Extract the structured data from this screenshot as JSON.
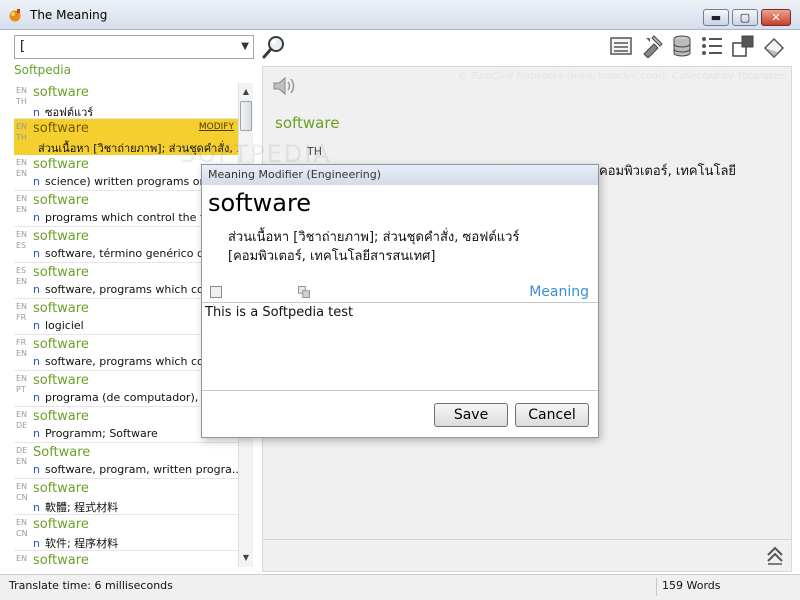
{
  "window": {
    "title": "The Meaning",
    "controls": {
      "minimize": "▬",
      "maximize": "▢",
      "close": "✕"
    }
  },
  "search": {
    "value": "[",
    "dropdown_icon": "▼"
  },
  "source": "Softpedia",
  "watermark": "SOFTPEDIA",
  "results": [
    {
      "lang1": "EN",
      "lang2": "TH",
      "word": "software",
      "pos": "n",
      "meaning": "ซอฟต์แวร์"
    },
    {
      "lang1": "EN",
      "lang2": "TH",
      "word": "software",
      "pos": "",
      "meaning": "ส่วนเนื้อหา [วิชาถ่ายภาพ]; ส่วนชุดคำสั่ง, ...",
      "action": "MODIFY",
      "selected": true
    },
    {
      "lang1": "EN",
      "lang2": "EN",
      "word": "software",
      "pos": "n",
      "meaning": "science) written programs or"
    },
    {
      "lang1": "EN",
      "lang2": "EN",
      "word": "software",
      "pos": "n",
      "meaning": "programs which control the fu"
    },
    {
      "lang1": "EN",
      "lang2": "ES",
      "word": "software",
      "pos": "n",
      "meaning": "software, término genérico q"
    },
    {
      "lang1": "ES",
      "lang2": "EN",
      "word": "software",
      "pos": "n",
      "meaning": "software, programs which co"
    },
    {
      "lang1": "EN",
      "lang2": "FR",
      "word": "software",
      "pos": "n",
      "meaning": "logiciel"
    },
    {
      "lang1": "FR",
      "lang2": "EN",
      "word": "software",
      "pos": "n",
      "meaning": "software, programs which co"
    },
    {
      "lang1": "EN",
      "lang2": "PT",
      "word": "software",
      "pos": "n",
      "meaning": "programa (de computador), s"
    },
    {
      "lang1": "EN",
      "lang2": "DE",
      "word": "software",
      "pos": "n",
      "meaning": "Programm; Software"
    },
    {
      "lang1": "DE",
      "lang2": "EN",
      "word": "Software",
      "pos": "n",
      "meaning": "software, program, written progra..."
    },
    {
      "lang1": "EN",
      "lang2": "CN",
      "word": "software",
      "pos": "n",
      "meaning": "軟體; 程式材料"
    },
    {
      "lang1": "EN",
      "lang2": "CN",
      "word": "software",
      "pos": "n",
      "meaning": "软件; 程序材料"
    },
    {
      "lang1": "EN",
      "lang2": "",
      "word": "software",
      "pos": "",
      "meaning": ""
    }
  ],
  "toolbar_icons": [
    "list-view-icon",
    "tools-icon",
    "database-icon",
    "bullet-list-icon",
    "window-icon",
    "eraser-icon"
  ],
  "detail": {
    "credit": "© TumCivil Networks (www.tumcivil.com). Collected by Yotaratee",
    "headword": "software",
    "lang": "TH",
    "def_tail": "คอมพิวเตอร์, เทคโนโลยี"
  },
  "dialog": {
    "title": "Meaning Modifier (Engineering)",
    "word": "software",
    "meaning": "ส่วนเนื้อหา [วิชาถ่ายภาพ]; ส่วนชุดคำสั่ง, ซอฟต์แวร์ [คอมพิวเตอร์, เทคโนโลยีสารสนเทศ]",
    "link": "Meaning",
    "note": "This is a Softpedia test",
    "save": "Save",
    "cancel": "Cancel"
  },
  "status": {
    "translate_time": "Translate time: 6 milliseconds",
    "word_count": "159 Words"
  },
  "colors": {
    "word_green": "#6aa125",
    "selected_row": "#f4cf2d",
    "link_blue": "#3a8fd6",
    "pos_blue": "#2a55c9"
  }
}
